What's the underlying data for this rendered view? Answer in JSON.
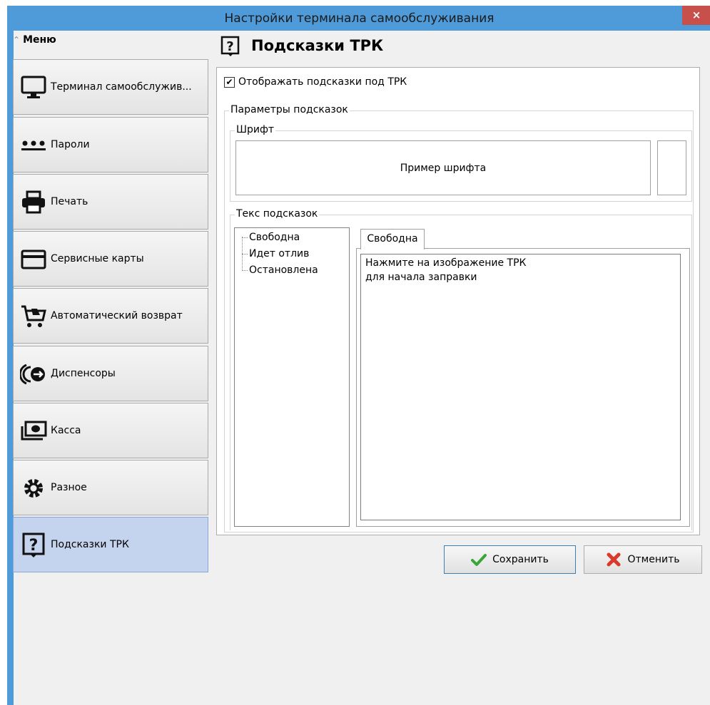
{
  "window": {
    "title": "Настройки терминала самообслуживания",
    "close_label": "×"
  },
  "sidebar": {
    "header": "Меню",
    "items": [
      {
        "label": "Терминал самообслужив...",
        "icon": "monitor-icon",
        "active": false
      },
      {
        "label": "Пароли",
        "icon": "password-dots-icon",
        "active": false
      },
      {
        "label": "Печать",
        "icon": "printer-icon",
        "active": false
      },
      {
        "label": "Сервисные карты",
        "icon": "card-icon",
        "active": false
      },
      {
        "label": "Автоматический возврат",
        "icon": "cart-return-icon",
        "active": false
      },
      {
        "label": "Диспенсоры",
        "icon": "dispenser-icon",
        "active": false
      },
      {
        "label": "Касса",
        "icon": "cash-icon",
        "active": false
      },
      {
        "label": "Разное",
        "icon": "gears-icon",
        "active": false
      },
      {
        "label": "Подсказки ТРК",
        "icon": "hint-icon",
        "active": true
      }
    ]
  },
  "main": {
    "title": "Подсказки ТРК",
    "show_hints_label": "Отображать подсказки под ТРК",
    "show_hints_checked": true,
    "params_group": "Параметры подсказок",
    "font_group": "Шрифт",
    "font_sample": "Пример шрифта",
    "hint_text_group": "Текс подсказок",
    "tree_items": [
      "Свободна",
      "Идет отлив",
      "Остановлена"
    ],
    "tab_label": "Свободна",
    "hint_text_line1": "Нажмите на изображение ТРК",
    "hint_text_line2": "для начала заправки"
  },
  "footer": {
    "save_label": "Сохранить",
    "cancel_label": "Отменить"
  },
  "colors": {
    "titlebar": "#4f9bd9",
    "close": "#c7504a",
    "active_item": "#c5d4ee",
    "save_check": "#3aa63a",
    "cancel_x": "#d93a2b"
  }
}
